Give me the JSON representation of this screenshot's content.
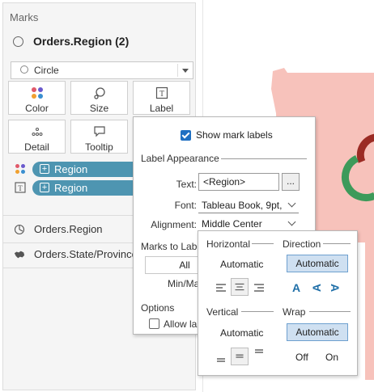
{
  "marks_card": {
    "header": "Marks",
    "title": "Orders.Region (2)",
    "mark_type": "Circle",
    "buttons": [
      {
        "label": "Color",
        "icon": "color-dots-icon"
      },
      {
        "label": "Size",
        "icon": "size-icon"
      },
      {
        "label": "Label",
        "icon": "label-icon"
      },
      {
        "label": "Detail",
        "icon": "detail-dots-icon"
      },
      {
        "label": "Tooltip",
        "icon": "tooltip-icon"
      }
    ],
    "pills": [
      {
        "label": "Region",
        "icon": "color-dots-icon"
      },
      {
        "label": "Region",
        "icon": "text-label-icon"
      }
    ],
    "fields": [
      {
        "label": "Orders.Region",
        "icon": "pie-angle-icon"
      },
      {
        "label": "Orders.State/Province",
        "icon": "map-icon"
      }
    ]
  },
  "label_popup": {
    "show_labels": "Show mark labels",
    "show_labels_checked": true,
    "appearance_title": "Label Appearance",
    "text_label": "Text:",
    "text_value": "<Region>",
    "ellipsis": "...",
    "font_label": "Font:",
    "font_value": "Tableau Book, 9pt, ...",
    "alignment_label": "Alignment:",
    "alignment_value": "Middle Center",
    "marks_to_label_title": "Marks to Label",
    "all_button": "All",
    "minmax_button": "Min/Max",
    "options_title": "Options",
    "allow_overlap": "Allow lab"
  },
  "alignment_popup": {
    "horizontal_title": "Horizontal",
    "direction_title": "Direction",
    "h_automatic": "Automatic",
    "dir_automatic": "Automatic",
    "dir_glyphs": [
      "A",
      "A",
      "A"
    ],
    "vertical_title": "Vertical",
    "wrap_title": "Wrap",
    "v_automatic": "Automatic",
    "wrap_automatic": "Automatic",
    "wrap_off": "Off",
    "wrap_on": "On"
  },
  "colors": {
    "pill": "#4e95b1",
    "map_fill": "#f7c2bb",
    "ring_red": "#9b2b24",
    "ring_green": "#3d9a5a",
    "selected_bg": "#cfe0f1"
  }
}
